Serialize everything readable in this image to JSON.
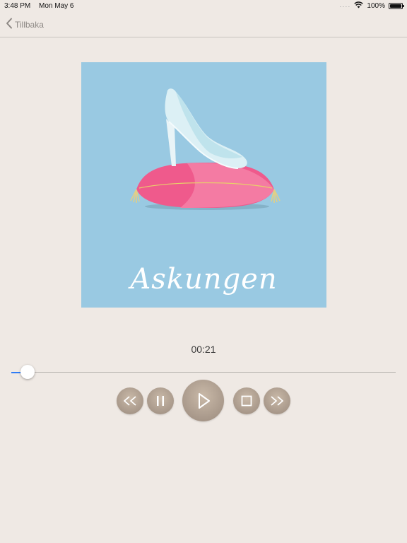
{
  "status_bar": {
    "time": "3:48 PM",
    "date": "Mon May 6",
    "battery": "100%"
  },
  "nav": {
    "back_label": "Tillbaka"
  },
  "cover": {
    "title": "Askungen"
  },
  "player": {
    "elapsed": "00:21",
    "progress_fraction": 0.042
  },
  "controls": [
    {
      "name": "rewind",
      "icon": "rewind-icon"
    },
    {
      "name": "pause",
      "icon": "pause-icon"
    },
    {
      "name": "play",
      "icon": "play-icon"
    },
    {
      "name": "stop",
      "icon": "stop-icon"
    },
    {
      "name": "fast-forward",
      "icon": "fast-forward-icon"
    }
  ]
}
